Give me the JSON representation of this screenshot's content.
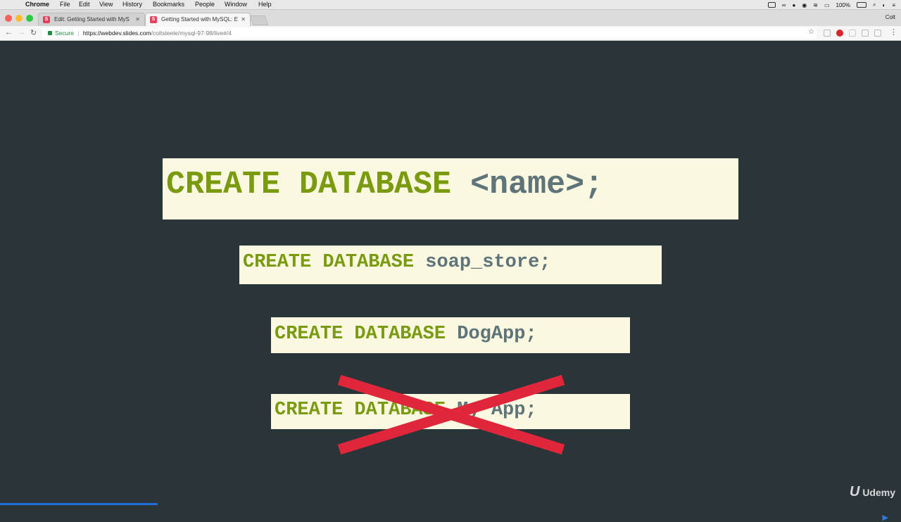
{
  "menubar": {
    "items": [
      "Chrome",
      "File",
      "Edit",
      "View",
      "History",
      "Bookmarks",
      "People",
      "Window",
      "Help"
    ],
    "battery": "100%",
    "user": "Colt"
  },
  "tabs": [
    {
      "title": "Edit: Getting Started with MyS",
      "favicon": "S",
      "active": false
    },
    {
      "title": "Getting Started with MySQL: E",
      "favicon": "S",
      "active": true
    }
  ],
  "profile_name": "Colt",
  "address": {
    "secure_label": "Secure",
    "url_host": "https://webdev.slides.com",
    "url_path": "/coltsteele/mysql-97-98/live#/4"
  },
  "slide": {
    "syntax": {
      "keyword": "CREATE DATABASE",
      "arg": "<name>;"
    },
    "example1": {
      "keyword": "CREATE DATABASE",
      "arg": "soap_store;"
    },
    "example2": {
      "keyword": "CREATE DATABASE",
      "arg": "DogApp;"
    },
    "example3": {
      "keyword": "CREATE DATABASE",
      "arg": "My App;",
      "crossed_out": true
    }
  },
  "branding": {
    "name": "Udemy"
  },
  "colors": {
    "slide_bg": "#2a3539",
    "box_bg": "#fbf8e2",
    "keyword": "#7a9a0f",
    "arg": "#5e7479",
    "cross": "#e0263a"
  }
}
